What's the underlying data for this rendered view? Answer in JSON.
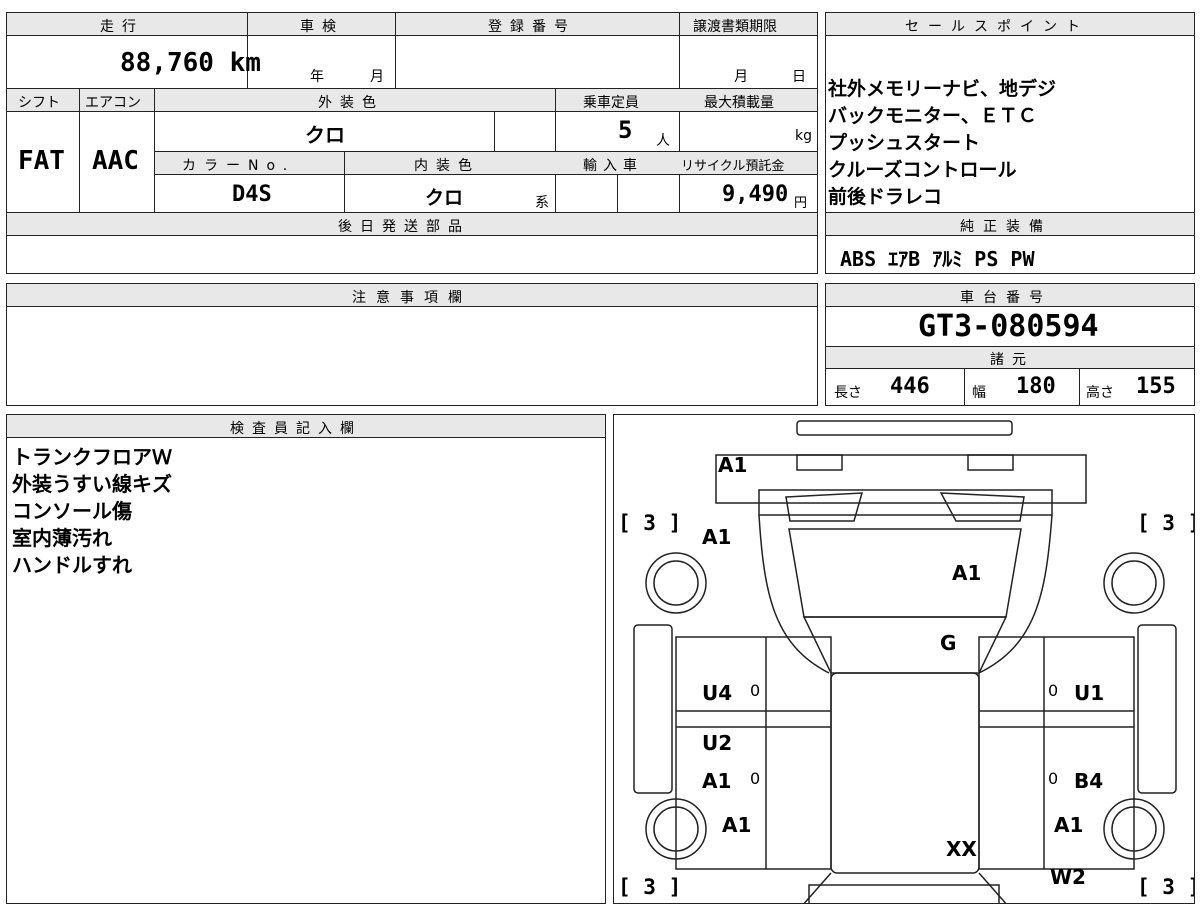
{
  "top": {
    "mileage_label": "走行",
    "mileage_value": "88,760 km",
    "inspection_label": "車検",
    "inspection_year_unit": "年",
    "inspection_month_unit": "月",
    "registration_label": "登録番号",
    "transfer_label": "譲渡書類期限",
    "transfer_month_unit": "月",
    "transfer_day_unit": "日",
    "shift_label": "シフト",
    "shift_value": "FAT",
    "ac_label": "エアコン",
    "ac_value": "AAC",
    "exterior_label": "外装色",
    "exterior_value": "クロ",
    "capacity_label": "乗車定員",
    "capacity_value": "5",
    "capacity_unit": "人",
    "maxload_label": "最大積載量",
    "maxload_unit": "kg",
    "color_no_label": "カラーNo.",
    "color_no_value": "D4S",
    "interior_label": "内装色",
    "interior_value": "クロ",
    "interior_unit": "系",
    "import_label": "輸入車",
    "recycle_label": "リサイクル預託金",
    "recycle_value": "9,490",
    "recycle_unit": "円",
    "later_parts_label": "後日発送部品"
  },
  "sales": {
    "header": "セールスポイント",
    "lines": [
      "社外メモリーナビ、地デジ",
      "バックモニター、ＥＴＣ",
      "プッシュスタート",
      "クルーズコントロール",
      "前後ドラレコ"
    ],
    "equipment_header": "純正装備",
    "equipment": "ABS ｴｱB ｱﾙﾐ PS PW"
  },
  "notes": {
    "header": "注意事項欄"
  },
  "chassis": {
    "header": "車台番号",
    "value": "GT3-080594",
    "specs_header": "諸元",
    "length_label": "長さ",
    "length_value": "446",
    "width_label": "幅",
    "width_value": "180",
    "height_label": "高さ",
    "height_value": "155"
  },
  "inspector": {
    "header": "検査員記入欄",
    "lines": [
      "トランクフロアＷ",
      "外装うすい線キズ",
      "コンソール傷",
      "室内薄汚れ",
      "ハンドルすれ"
    ]
  },
  "diagram": {
    "tire_fl": "[ 3 ]",
    "tire_fr": "[ 3 ]",
    "tire_rl": "[ 3 ]",
    "tire_rr": "[ 3 ]",
    "marks": {
      "rear_bumper": "A1",
      "rear_left_fender": "A1",
      "trunk": "A1",
      "rear_glass": "G",
      "left_rear_door": "U4",
      "left_rear_door_0": "0",
      "left_front_door": "U2",
      "left_front_door_a": "A1",
      "left_front_door_0": "0",
      "left_front_fender": "A1",
      "right_rear_door_0": "0",
      "right_rear_door": "U1",
      "right_front_door_0": "0",
      "right_front_door": "B4",
      "right_front_fender": "A1",
      "hood": "XX",
      "front_right": "W2"
    }
  }
}
